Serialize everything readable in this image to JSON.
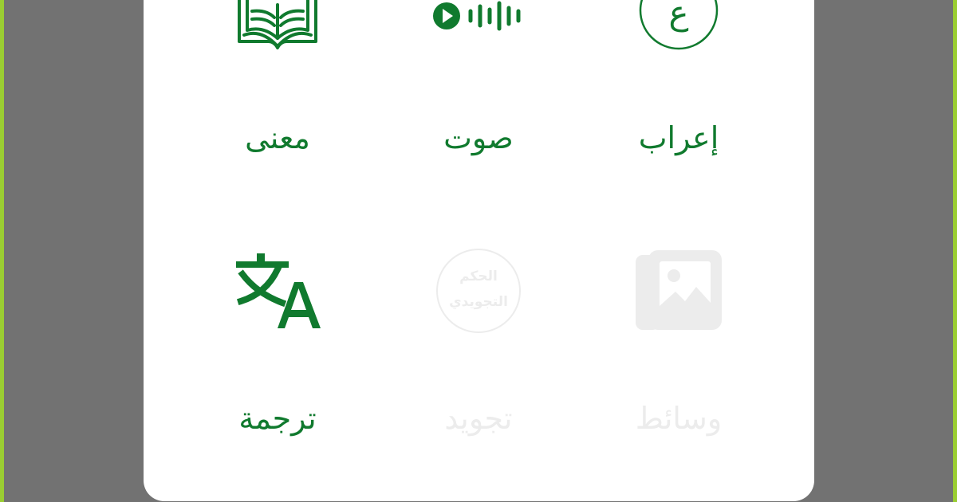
{
  "options": [
    {
      "id": "meaning",
      "label": "معنى",
      "icon": "book-icon",
      "enabled": true
    },
    {
      "id": "audio",
      "label": "صوت",
      "icon": "audio-waveform-icon",
      "enabled": true
    },
    {
      "id": "irab",
      "label": "إعراب",
      "icon": "arabic-letter-circle-icon",
      "enabled": true
    },
    {
      "id": "translate",
      "label": "ترجمة",
      "icon": "translate-icon",
      "enabled": true
    },
    {
      "id": "tajweed",
      "label": "تجويد",
      "icon": "tajweed-rules-icon",
      "enabled": false,
      "icon_text": [
        "الحكم",
        "التجويدي"
      ]
    },
    {
      "id": "media",
      "label": "وسائط",
      "icon": "media-gallery-icon",
      "enabled": false
    }
  ],
  "icons": {
    "irab_letter": "ع"
  },
  "colors": {
    "accent": "#107a2e",
    "disabled": "#ececec",
    "backdrop": "#727272",
    "sheet": "#ffffff",
    "edge": "#9acd32"
  }
}
